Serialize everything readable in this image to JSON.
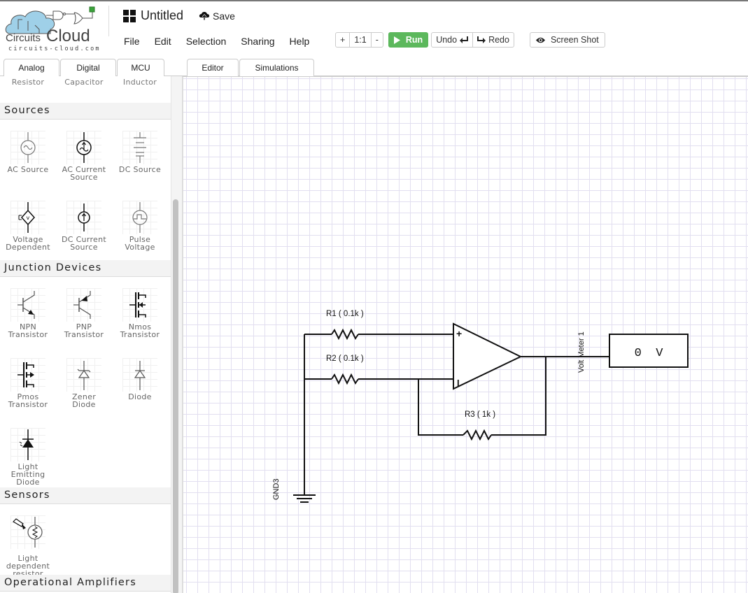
{
  "app": {
    "logo_text": "CircuitsCloud",
    "logo_subtext": "circuits-cloud.com",
    "document_title": "Untitled",
    "save_label": "Save"
  },
  "menu": [
    "File",
    "Edit",
    "Selection",
    "Sharing",
    "Help"
  ],
  "toolbar": {
    "zoom_in": "+",
    "zoom_reset": "1:1",
    "zoom_out": "-",
    "run": "Run",
    "undo": "Undo",
    "redo": "Redo",
    "screenshot": "Screen Shot",
    "run_color": "#5cb85c"
  },
  "library_tabs": [
    {
      "label": "Analog",
      "active": true
    },
    {
      "label": "Digital",
      "active": false
    },
    {
      "label": "MCU",
      "active": false
    }
  ],
  "editor_tabs": [
    {
      "label": "Editor",
      "active": true
    },
    {
      "label": "Simulations",
      "active": false
    }
  ],
  "sidebar": {
    "partial_row": [
      "Resistor",
      "Capacitor",
      "Inductor"
    ],
    "sections": [
      {
        "title": "Sources",
        "items": [
          {
            "label1": "AC Source",
            "label2": "",
            "icon": "ac-source-icon"
          },
          {
            "label1": "AC Current",
            "label2": "Source",
            "icon": "ac-current-source-icon"
          },
          {
            "label1": "DC Source",
            "label2": "",
            "icon": "dc-source-icon"
          },
          {
            "label1": "Voltage",
            "label2": "Dependent",
            "icon": "voltage-dependent-icon"
          },
          {
            "label1": "DC Current",
            "label2": "Source",
            "icon": "dc-current-source-icon"
          },
          {
            "label1": "Pulse",
            "label2": "Voltage",
            "icon": "pulse-voltage-icon"
          }
        ]
      },
      {
        "title": "Junction Devices",
        "items": [
          {
            "label1": "NPN",
            "label2": "Transistor",
            "icon": "npn-transistor-icon"
          },
          {
            "label1": "PNP",
            "label2": "Transistor",
            "icon": "pnp-transistor-icon"
          },
          {
            "label1": "Nmos",
            "label2": "Transistor",
            "icon": "nmos-transistor-icon"
          },
          {
            "label1": "Pmos",
            "label2": "Transistor",
            "icon": "pmos-transistor-icon"
          },
          {
            "label1": "Zener",
            "label2": "Diode",
            "icon": "zener-diode-icon"
          },
          {
            "label1": "Diode",
            "label2": "",
            "icon": "diode-icon"
          },
          {
            "label1": "Light",
            "label2": "Emitting",
            "label3": "Diode",
            "icon": "led-icon"
          }
        ]
      },
      {
        "title": "Sensors",
        "items": [
          {
            "label1": "Light",
            "label2": "dependent",
            "label3": "resistor",
            "icon": "ldr-icon"
          }
        ]
      },
      {
        "title": "Operational Amplifiers",
        "items": []
      }
    ]
  },
  "circuit": {
    "r1_label": "R1 ( 0.1k )",
    "r2_label": "R2 ( 0.1k )",
    "r3_label": "R3 ( 1k )",
    "opamp_plus": "+",
    "opamp_minus": "I",
    "voltmeter_label": "Volt Meter 1",
    "voltmeter_reading": "0  V",
    "ground_label": "GND3"
  }
}
